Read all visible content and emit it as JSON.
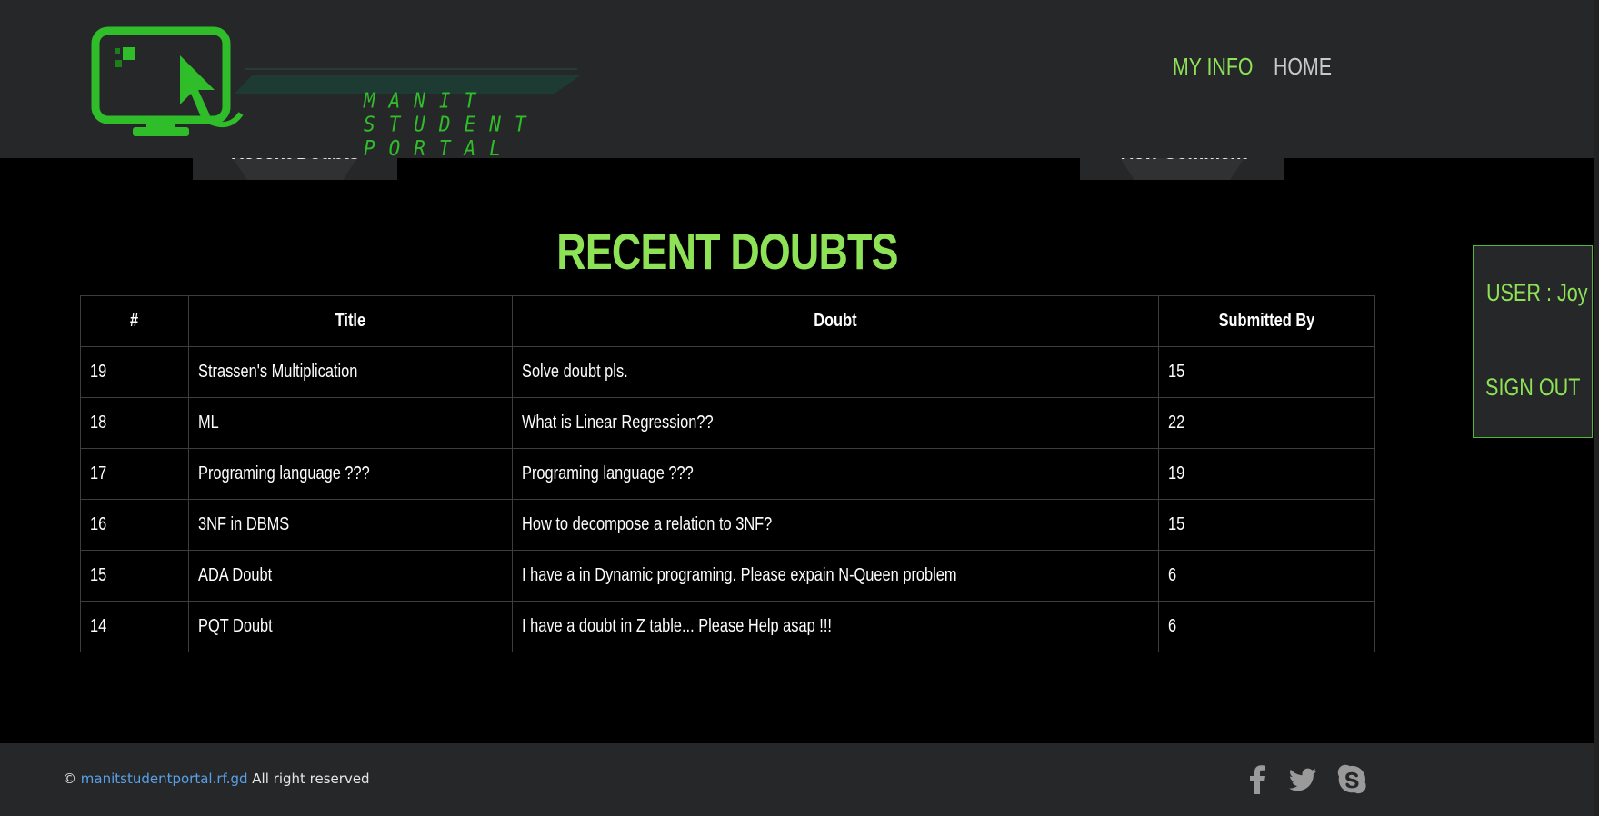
{
  "header": {
    "logo_text": "MANIT STUDENT PORTAL",
    "nav": {
      "my_info": "MY INFO",
      "home": "HOME"
    }
  },
  "tabs": {
    "left": "Recent Doubts",
    "right": "View Comment"
  },
  "main": {
    "title": "RECENT DOUBTS",
    "columns": [
      "#",
      "Title",
      "Doubt",
      "Submitted By"
    ],
    "rows": [
      {
        "id": "19",
        "title": "Strassen's Multiplication",
        "doubt": "Solve doubt pls.",
        "by": "15"
      },
      {
        "id": "18",
        "title": "ML",
        "doubt": "What is Linear Regression??",
        "by": "22"
      },
      {
        "id": "17",
        "title": "Programing language ???",
        "doubt": "Programing language ???",
        "by": "19"
      },
      {
        "id": "16",
        "title": "3NF in DBMS",
        "doubt": "How to decompose a relation to 3NF?",
        "by": "15"
      },
      {
        "id": "15",
        "title": "ADA Doubt",
        "doubt": "I have a in Dynamic programing. Please expain N-Queen problem",
        "by": "6"
      },
      {
        "id": "14",
        "title": "PQT Doubt",
        "doubt": "I have a doubt in Z table... Please Help asap !!!",
        "by": "6"
      }
    ]
  },
  "user_panel": {
    "user": "USER : Joy",
    "signout": "SIGN OUT"
  },
  "footer": {
    "symbol": "©",
    "link": "manitstudentportal.rf.gd",
    "suffix": " All right reserved",
    "icons": [
      "facebook-icon",
      "twitter-icon",
      "skype-icon"
    ]
  },
  "colors": {
    "accent": "#8ee256",
    "header_bg": "#262728",
    "page_bg": "#000000",
    "logo_green": "#2fbd2a",
    "link_blue": "#5aa0e6"
  }
}
